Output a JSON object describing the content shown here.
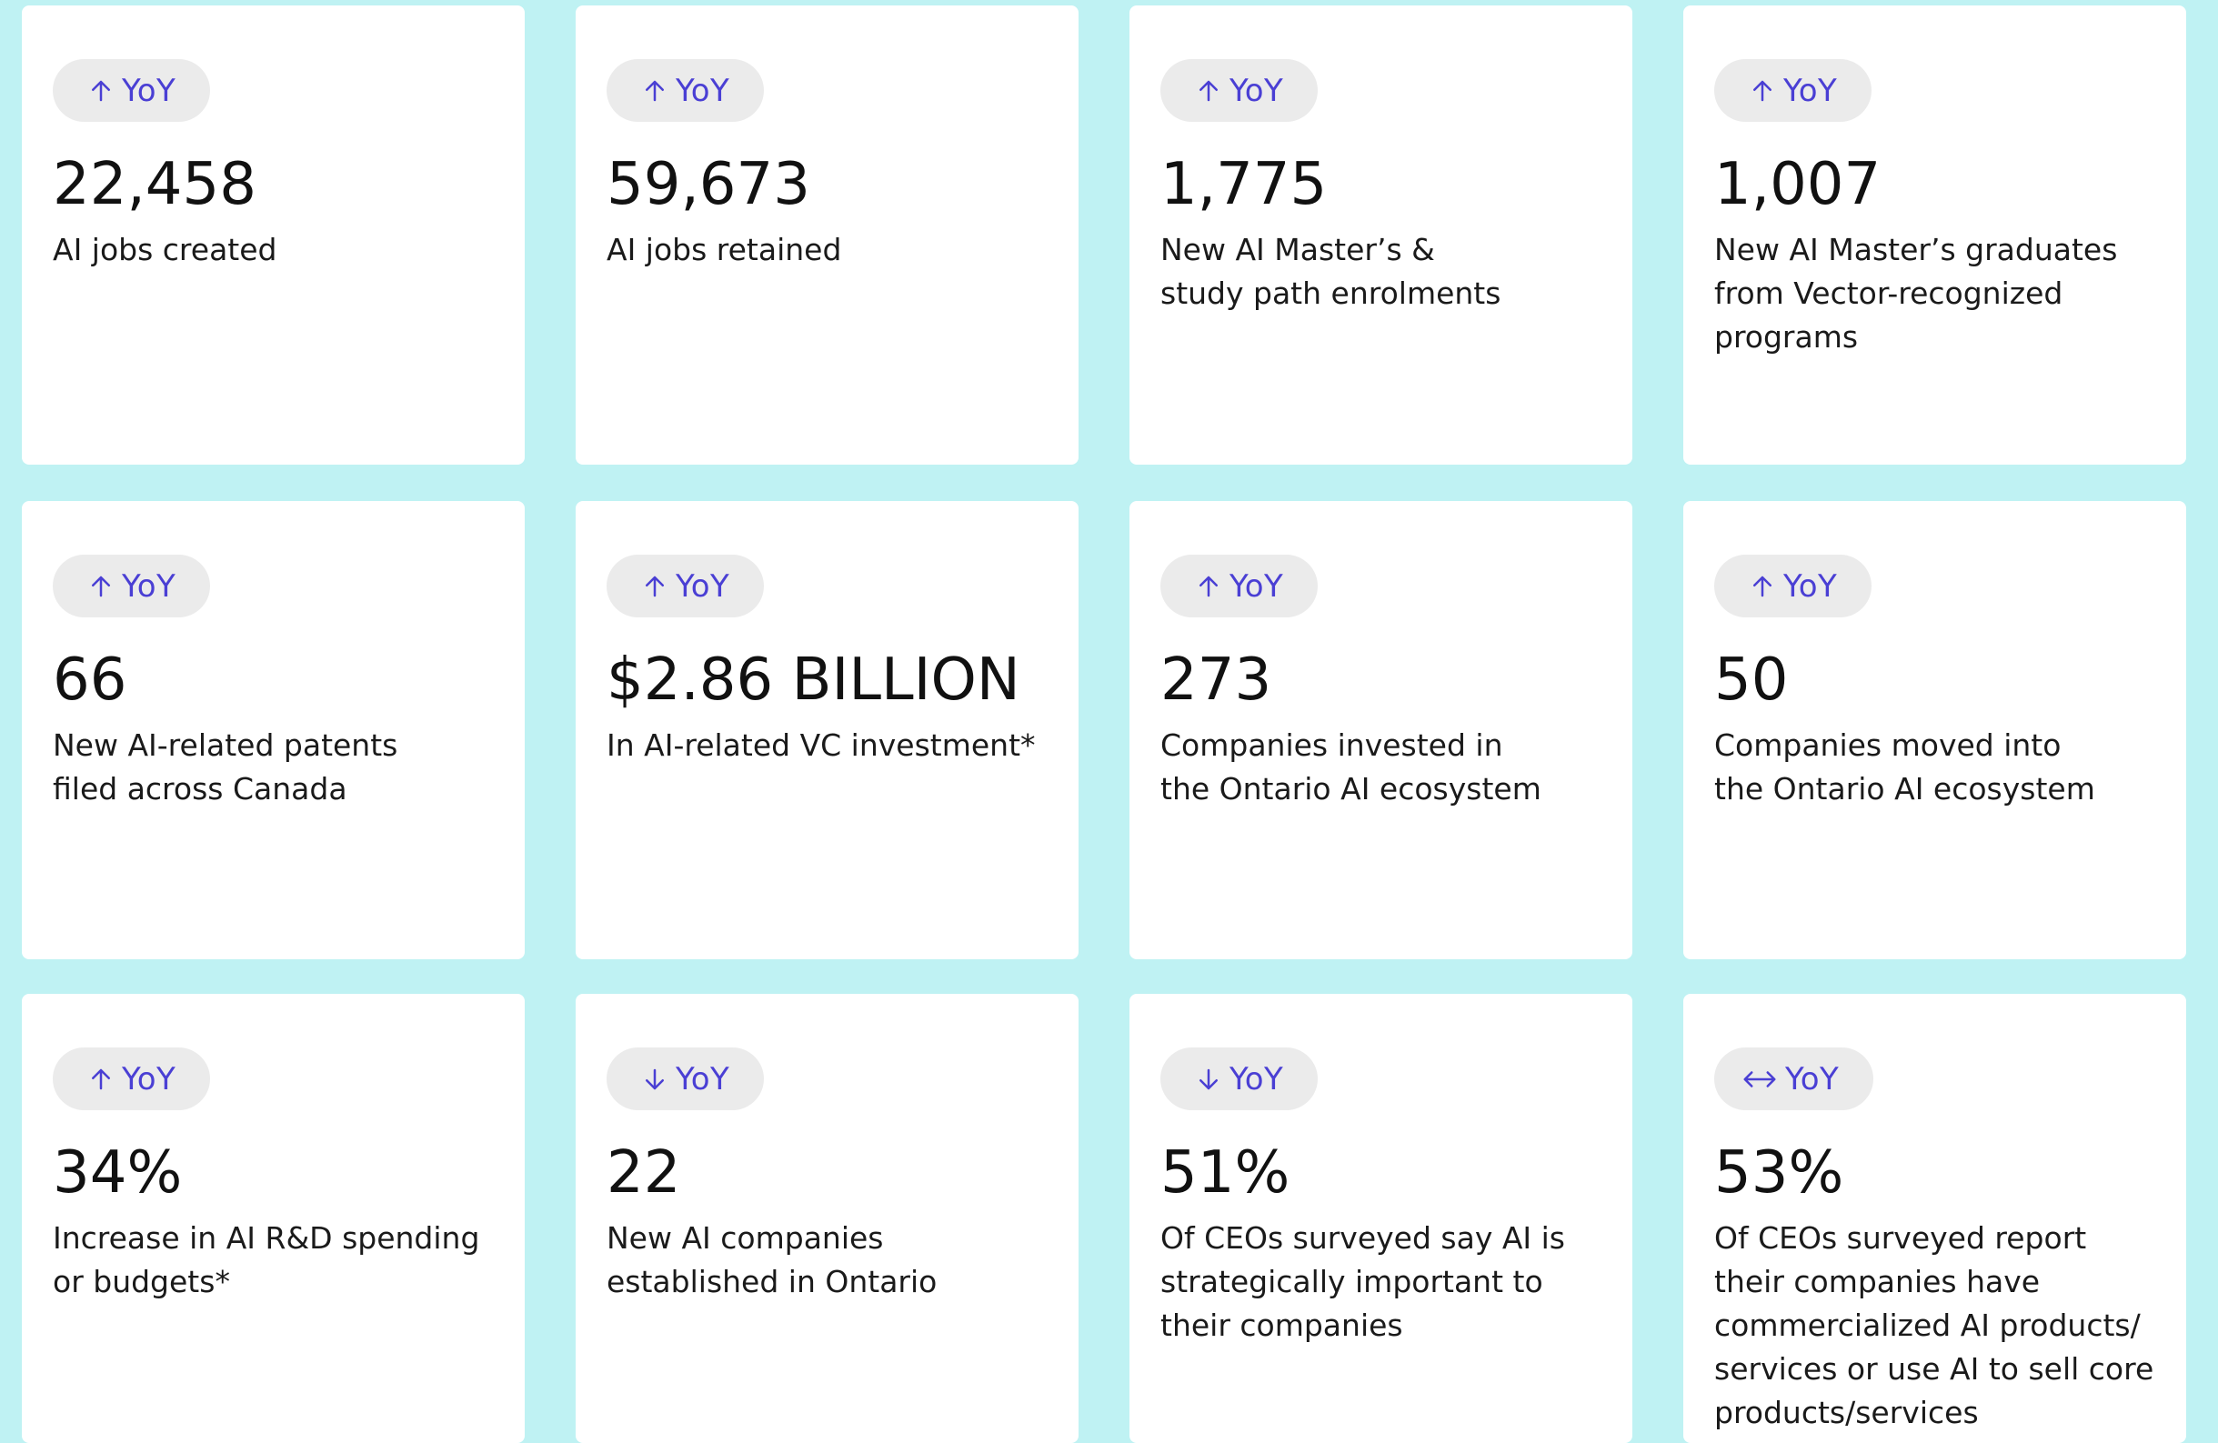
{
  "badge_text": "YoY",
  "colors": {
    "background": "#bff2f3",
    "card": "#ffffff",
    "badge_bg": "#ebebeb",
    "badge_text": "#4a3fd4",
    "value_text": "#111111"
  },
  "stats": [
    {
      "trend": "up",
      "trend_icon": "arrow-up-icon",
      "value": "22,458",
      "label": "AI jobs created"
    },
    {
      "trend": "up",
      "trend_icon": "arrow-up-icon",
      "value": "59,673",
      "label": "AI jobs retained"
    },
    {
      "trend": "up",
      "trend_icon": "arrow-up-icon",
      "value": "1,775",
      "label": "New AI Master’s & study path enrolments"
    },
    {
      "trend": "up",
      "trend_icon": "arrow-up-icon",
      "value": "1,007",
      "label": "New AI Master’s graduates from Vector-recognized programs"
    },
    {
      "trend": "up",
      "trend_icon": "arrow-up-icon",
      "value": "66",
      "label": "New AI-related patents filed across Canada"
    },
    {
      "trend": "up",
      "trend_icon": "arrow-up-icon",
      "value": "$2.86 BILLION",
      "label": "In AI-related VC investment*"
    },
    {
      "trend": "up",
      "trend_icon": "arrow-up-icon",
      "value": "273",
      "label": "Companies invested in the Ontario AI ecosystem"
    },
    {
      "trend": "up",
      "trend_icon": "arrow-up-icon",
      "value": "50",
      "label": "Companies moved into the Ontario AI ecosystem"
    },
    {
      "trend": "up",
      "trend_icon": "arrow-up-icon",
      "value": "34%",
      "label": "Increase in AI R&D spending or budgets*"
    },
    {
      "trend": "down",
      "trend_icon": "arrow-down-icon",
      "value": "22",
      "label": "New AI companies established in Ontario"
    },
    {
      "trend": "down",
      "trend_icon": "arrow-down-icon",
      "value": "51%",
      "label": "Of CEOs surveyed say AI is strategically important to their companies"
    },
    {
      "trend": "flat",
      "trend_icon": "arrow-left-right-icon",
      "value": "53%",
      "label": "Of CEOs surveyed report their companies have commercialized AI products/ services or use AI to sell core products/services"
    }
  ]
}
